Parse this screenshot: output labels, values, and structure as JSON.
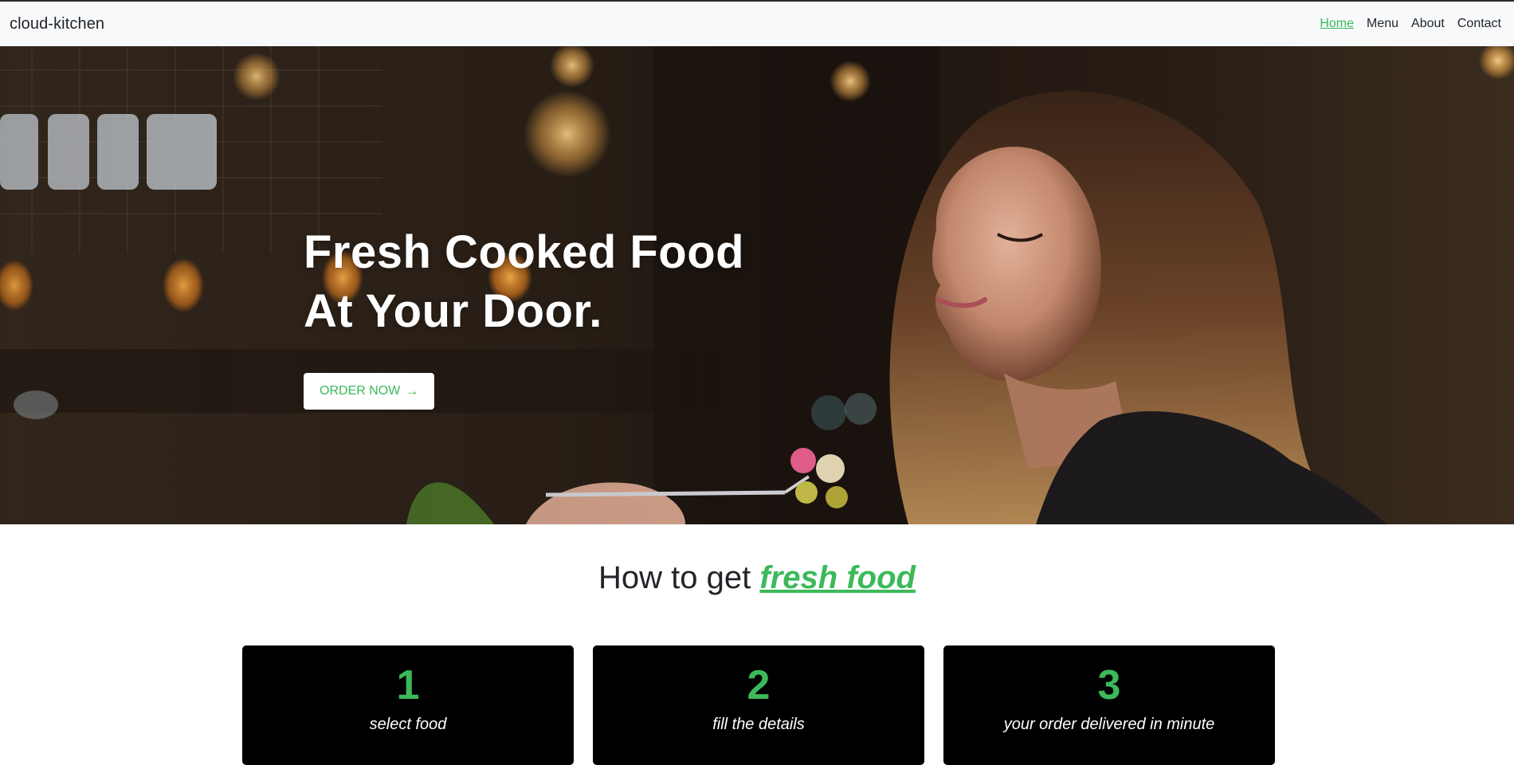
{
  "navbar": {
    "brand": "cloud-kitchen",
    "links": [
      "Home",
      "Menu",
      "About",
      "Contact"
    ],
    "active": "Home"
  },
  "hero": {
    "title_line1": "Fresh Cooked Food",
    "title_line2": "At Your Door.",
    "cta_label": "ORDER NOW",
    "cta_icon": "arrow-right-icon",
    "image": "woman-eating-pasta-restaurant-photo"
  },
  "how": {
    "title_prefix": "How to get",
    "title_accent": "fresh food"
  },
  "steps": [
    {
      "number": "1",
      "label": "select food"
    },
    {
      "number": "2",
      "label": "fill the details"
    },
    {
      "number": "3",
      "label": "your order delivered in minute"
    }
  ],
  "colors": {
    "accent": "#3cb95a",
    "navbar_bg": "#f8f9fa",
    "card_bg": "#000000",
    "text": "#212529"
  }
}
